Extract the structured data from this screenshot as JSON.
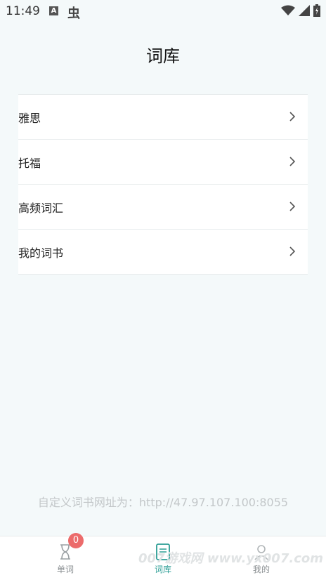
{
  "status_bar": {
    "time": "11:49",
    "icons": [
      "a-icon",
      "bug-icon",
      "wifi-icon",
      "signal-icon",
      "battery-icon"
    ]
  },
  "header": {
    "title": "词库"
  },
  "library_list": {
    "items": [
      {
        "label": "雅思"
      },
      {
        "label": "托福"
      },
      {
        "label": "高频词汇"
      },
      {
        "label": "我的词书"
      }
    ]
  },
  "custom_url_text": "自定义词书网址为：http://47.97.107.100:8055",
  "bottom_nav": {
    "tabs": [
      {
        "label": "单词",
        "icon": "hourglass-icon",
        "badge": "0",
        "active": false
      },
      {
        "label": "词库",
        "icon": "book-icon",
        "active": true
      },
      {
        "label": "我的",
        "icon": "user-icon",
        "active": false
      }
    ],
    "active_color": "#2a9d94",
    "inactive_color": "#8a8f92"
  },
  "watermark": "007游戏网 www.yx007.com"
}
